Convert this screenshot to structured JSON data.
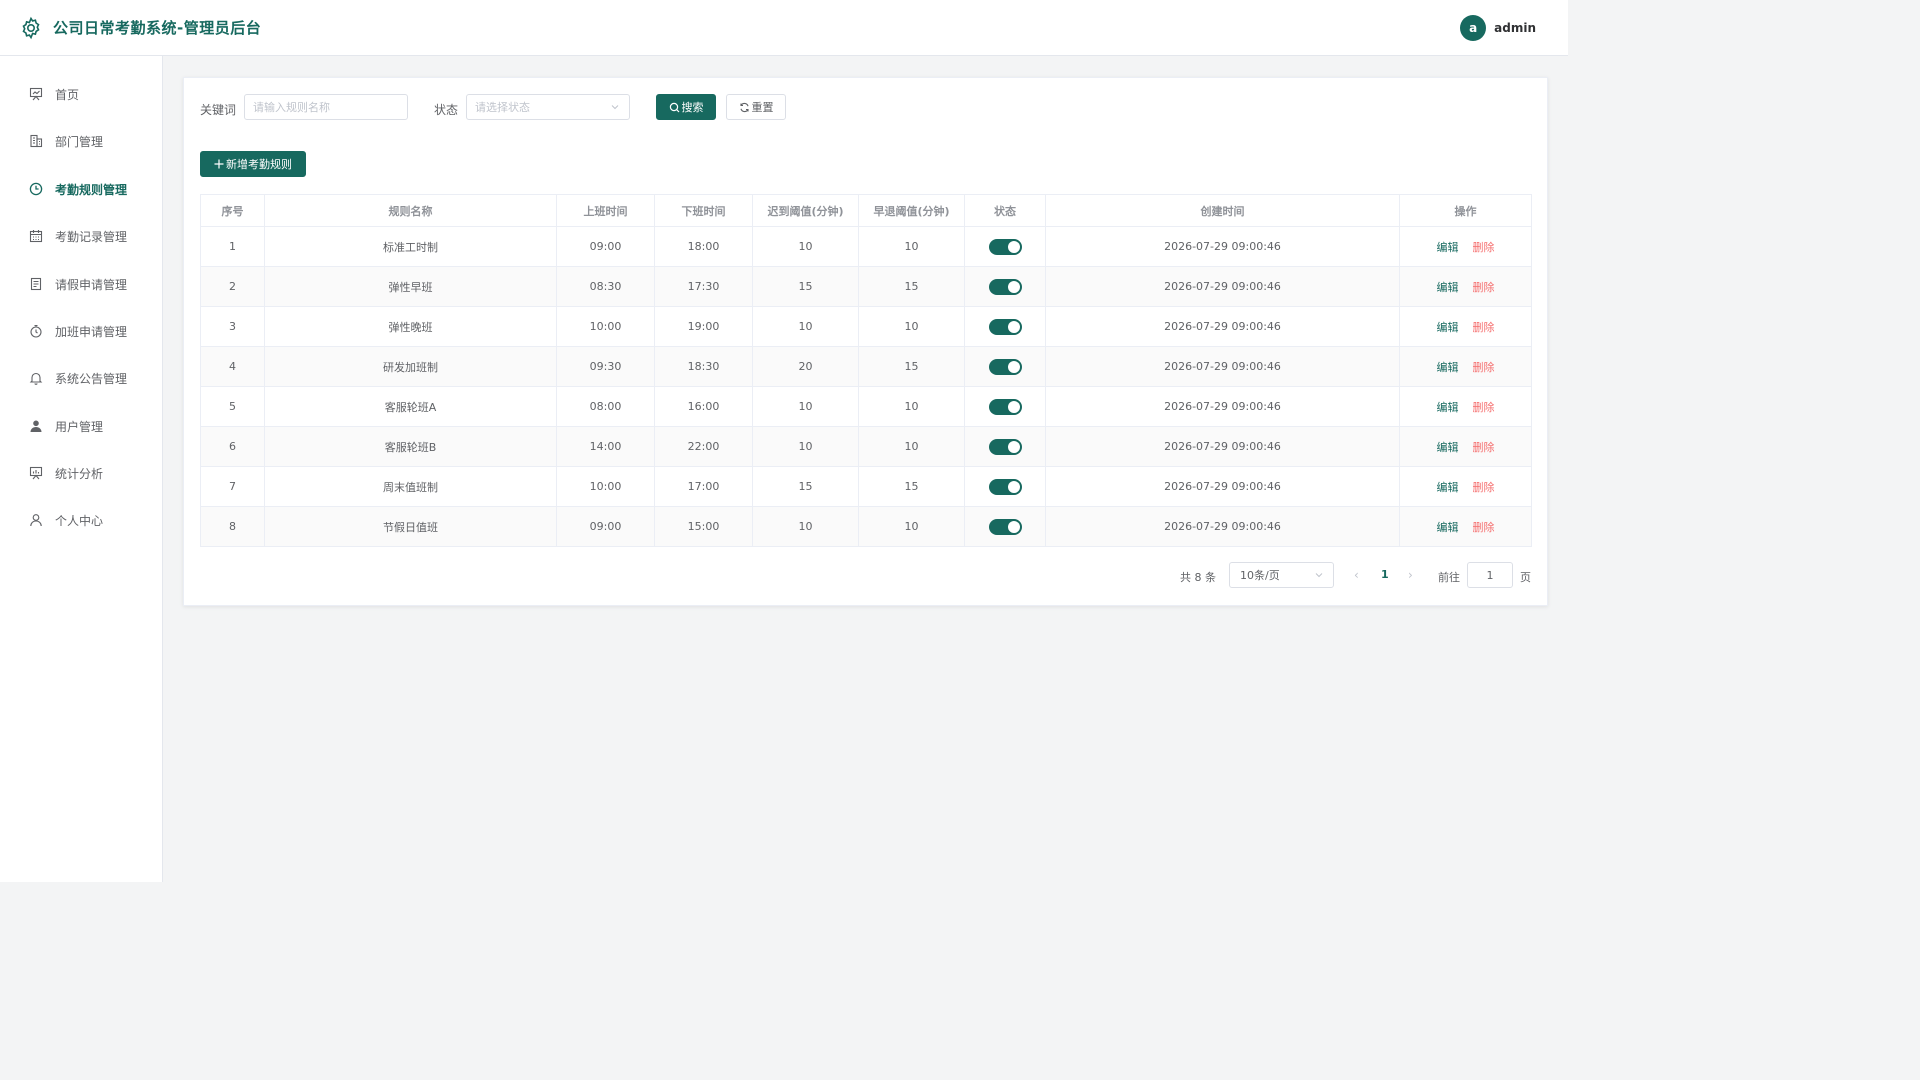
{
  "header": {
    "title": "公司日常考勤系统-管理员后台",
    "avatar_letter": "a",
    "username": "admin",
    "accent_color": "#17695f"
  },
  "sidebar": {
    "items": [
      {
        "label": "首页",
        "icon": "presentation-icon"
      },
      {
        "label": "部门管理",
        "icon": "building-icon"
      },
      {
        "label": "考勤规则管理",
        "icon": "clock-icon",
        "active": true
      },
      {
        "label": "考勤记录管理",
        "icon": "calendar-icon"
      },
      {
        "label": "请假申请管理",
        "icon": "document-icon"
      },
      {
        "label": "加班申请管理",
        "icon": "timer-icon"
      },
      {
        "label": "系统公告管理",
        "icon": "bell-icon"
      },
      {
        "label": "用户管理",
        "icon": "user-filled-icon"
      },
      {
        "label": "统计分析",
        "icon": "chart-board-icon"
      },
      {
        "label": "个人中心",
        "icon": "user-icon"
      }
    ]
  },
  "filters": {
    "keyword_label": "关键词",
    "keyword_placeholder": "请输入规则名称",
    "keyword_value": "",
    "status_label": "状态",
    "status_placeholder": "请选择状态",
    "search_label": "搜索",
    "reset_label": "重置"
  },
  "add_button_label": "新增考勤规则",
  "table": {
    "columns": [
      "序号",
      "规则名称",
      "上班时间",
      "下班时间",
      "迟到阈值(分钟)",
      "早退阈值(分钟)",
      "状态",
      "创建时间",
      "操作"
    ],
    "rows": [
      {
        "index": "1",
        "name": "标准工时制",
        "start": "09:00",
        "end": "18:00",
        "late": "10",
        "early": "10",
        "enabled": true,
        "created": "2026-07-29 09:00:46"
      },
      {
        "index": "2",
        "name": "弹性早班",
        "start": "08:30",
        "end": "17:30",
        "late": "15",
        "early": "15",
        "enabled": true,
        "created": "2026-07-29 09:00:46"
      },
      {
        "index": "3",
        "name": "弹性晚班",
        "start": "10:00",
        "end": "19:00",
        "late": "10",
        "early": "10",
        "enabled": true,
        "created": "2026-07-29 09:00:46"
      },
      {
        "index": "4",
        "name": "研发加班制",
        "start": "09:30",
        "end": "18:30",
        "late": "20",
        "early": "15",
        "enabled": true,
        "created": "2026-07-29 09:00:46"
      },
      {
        "index": "5",
        "name": "客服轮班A",
        "start": "08:00",
        "end": "16:00",
        "late": "10",
        "early": "10",
        "enabled": true,
        "created": "2026-07-29 09:00:46"
      },
      {
        "index": "6",
        "name": "客服轮班B",
        "start": "14:00",
        "end": "22:00",
        "late": "10",
        "early": "10",
        "enabled": true,
        "created": "2026-07-29 09:00:46"
      },
      {
        "index": "7",
        "name": "周末值班制",
        "start": "10:00",
        "end": "17:00",
        "late": "15",
        "early": "15",
        "enabled": true,
        "created": "2026-07-29 09:00:46"
      },
      {
        "index": "8",
        "name": "节假日值班",
        "start": "09:00",
        "end": "15:00",
        "late": "10",
        "early": "10",
        "enabled": true,
        "created": "2026-07-29 09:00:46"
      }
    ],
    "edit_label": "编辑",
    "delete_label": "删除"
  },
  "pagination": {
    "total_text": "共 8 条",
    "page_size": "10条/页",
    "current_page": "1",
    "goto_label": "前往",
    "goto_value": "1",
    "page_suffix": "页"
  }
}
